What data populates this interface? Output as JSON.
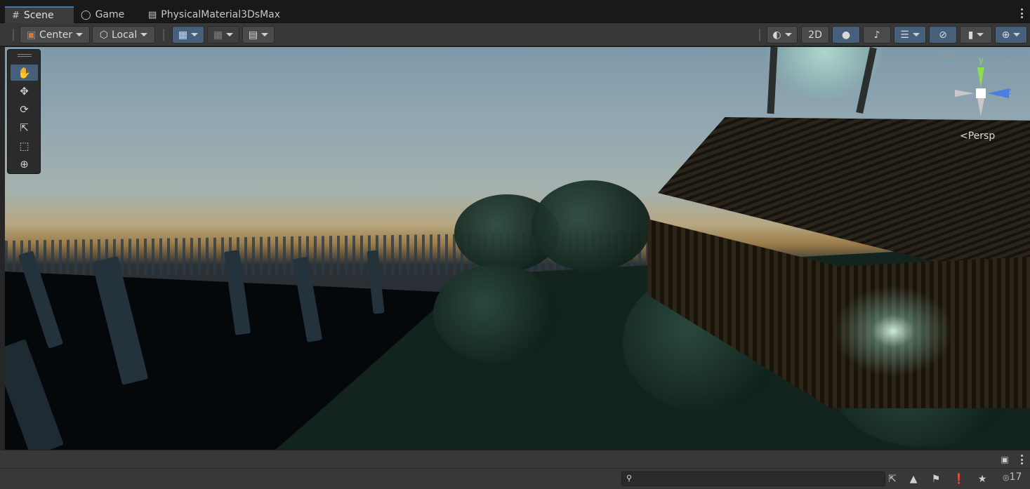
{
  "tabs": [
    {
      "label": "Scene",
      "icon": "grid-icon"
    },
    {
      "label": "Game",
      "icon": "gamepad-icon"
    },
    {
      "label": "PhysicalMaterial3DsMax",
      "icon": "script-icon"
    }
  ],
  "toolbar": {
    "pivot_label": "Center",
    "space_label": "Local",
    "mode_2d_label": "2D"
  },
  "scene_view": {
    "projection_label": "Persp",
    "gizmo_axes": {
      "y": "y",
      "z": "z"
    }
  },
  "bottom": {
    "search_placeholder": "",
    "visible_count": "17"
  },
  "colors": {
    "accent": "#3a79bb",
    "active_button": "#46607c",
    "toolbar_bg": "#383838",
    "gizmo_y": "#88dd44",
    "gizmo_z": "#4a7fe0"
  }
}
